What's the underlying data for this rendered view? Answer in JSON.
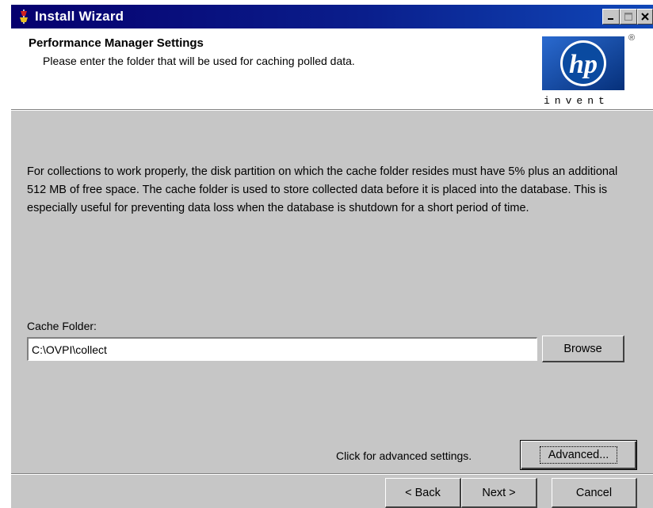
{
  "window": {
    "title": "Install Wizard",
    "colors": {
      "titlebar": "#06006e",
      "face": "#c6c6c6",
      "hp_blue": "#0a4aa0"
    }
  },
  "titlebar_buttons": {
    "minimize_icon": "minimize-icon",
    "maximize_icon": "maximize-icon",
    "close_icon": "close-icon"
  },
  "header": {
    "title": "Performance Manager Settings",
    "subtitle": "Please enter the folder that will be used for caching polled data.",
    "logo": {
      "brand": "hp",
      "tagline": "invent",
      "reg_mark": "®"
    }
  },
  "body": {
    "description": "For collections to work properly, the disk partition on which the cache folder resides must have 5% plus an additional 512 MB of free space. The cache folder is used to store collected data before it is placed into the database. This is especially useful for preventing data loss when the database is shutdown for a short period of time."
  },
  "cache": {
    "label": "Cache Folder:",
    "value": "C:\\OVPI\\collect",
    "browse_label": "Browse"
  },
  "advanced": {
    "hint": "Click for advanced settings.",
    "button_label": "Advanced..."
  },
  "footer": {
    "back_label": "< Back",
    "next_label": "Next >",
    "cancel_label": "Cancel"
  }
}
